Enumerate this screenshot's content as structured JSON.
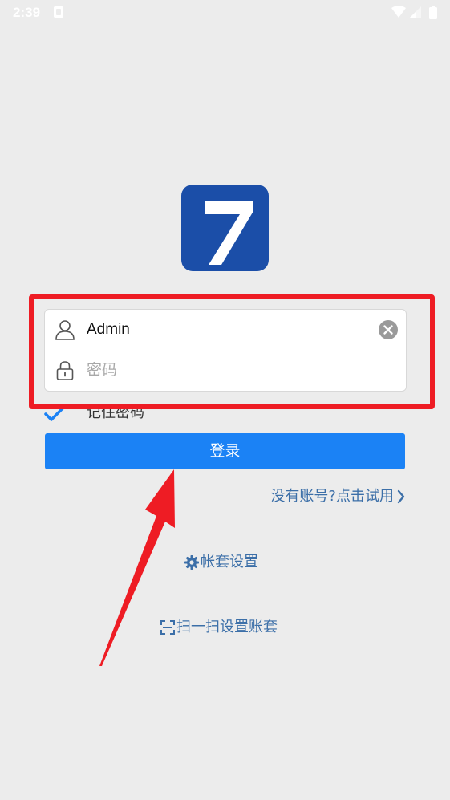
{
  "status_bar": {
    "time": "2:39"
  },
  "login_form": {
    "username": {
      "value": "Admin",
      "icon": "user-icon"
    },
    "password": {
      "placeholder": "密码",
      "icon": "lock-icon"
    },
    "remember_label": "记住密码",
    "remember_checked": true,
    "login_button_label": "登录"
  },
  "links": {
    "trial": "没有账号?点击试用",
    "account_settings": "帐套设置",
    "scan_settings": "扫一扫设置账套"
  },
  "colors": {
    "background": "#ececec",
    "primary_button": "#1b82f5",
    "link_text": "#3c6fa8",
    "logo_blue": "#1b4ea8",
    "annotation_red": "#ee1c24"
  }
}
